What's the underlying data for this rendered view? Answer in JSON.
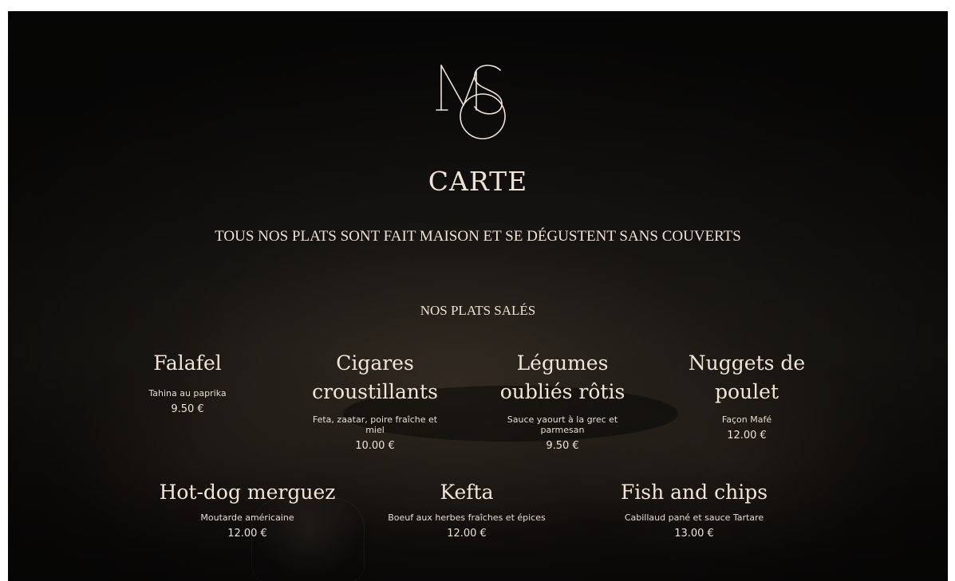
{
  "header": {
    "logo_icon": "ms-monogram-icon",
    "title": "CARTE",
    "subtitle": "TOUS NOS PLATS SONT FAIT MAISON ET SE DÉGUSTENT SANS COUVERTS"
  },
  "section": {
    "title": "NOS PLATS SALÉS"
  },
  "dishes": [
    {
      "name": "Falafel",
      "description": "Tahina au paprika",
      "price": "9.50 €"
    },
    {
      "name": "Cigares croustillants",
      "description": "Feta, zaatar, poire fraîche et miel",
      "price": "10.00 €"
    },
    {
      "name": "Légumes oubliés rôtis",
      "description": "Sauce yaourt à la grec et parmesan",
      "price": "9.50 €"
    },
    {
      "name": "Nuggets de poulet",
      "description": "Façon Mafé",
      "price": "12.00 €"
    },
    {
      "name": "Hot-dog merguez",
      "description": "Moutarde américaine",
      "price": "12.00 €"
    },
    {
      "name": "Kefta",
      "description": "Boeuf aux herbes fraîches et épices",
      "price": "12.00 €"
    },
    {
      "name": "Fish and chips",
      "description": "Cabillaud pané et sauce Tartare",
      "price": "13.00 €"
    }
  ],
  "colors": {
    "text": "#efe2d5",
    "background": "#141210"
  }
}
